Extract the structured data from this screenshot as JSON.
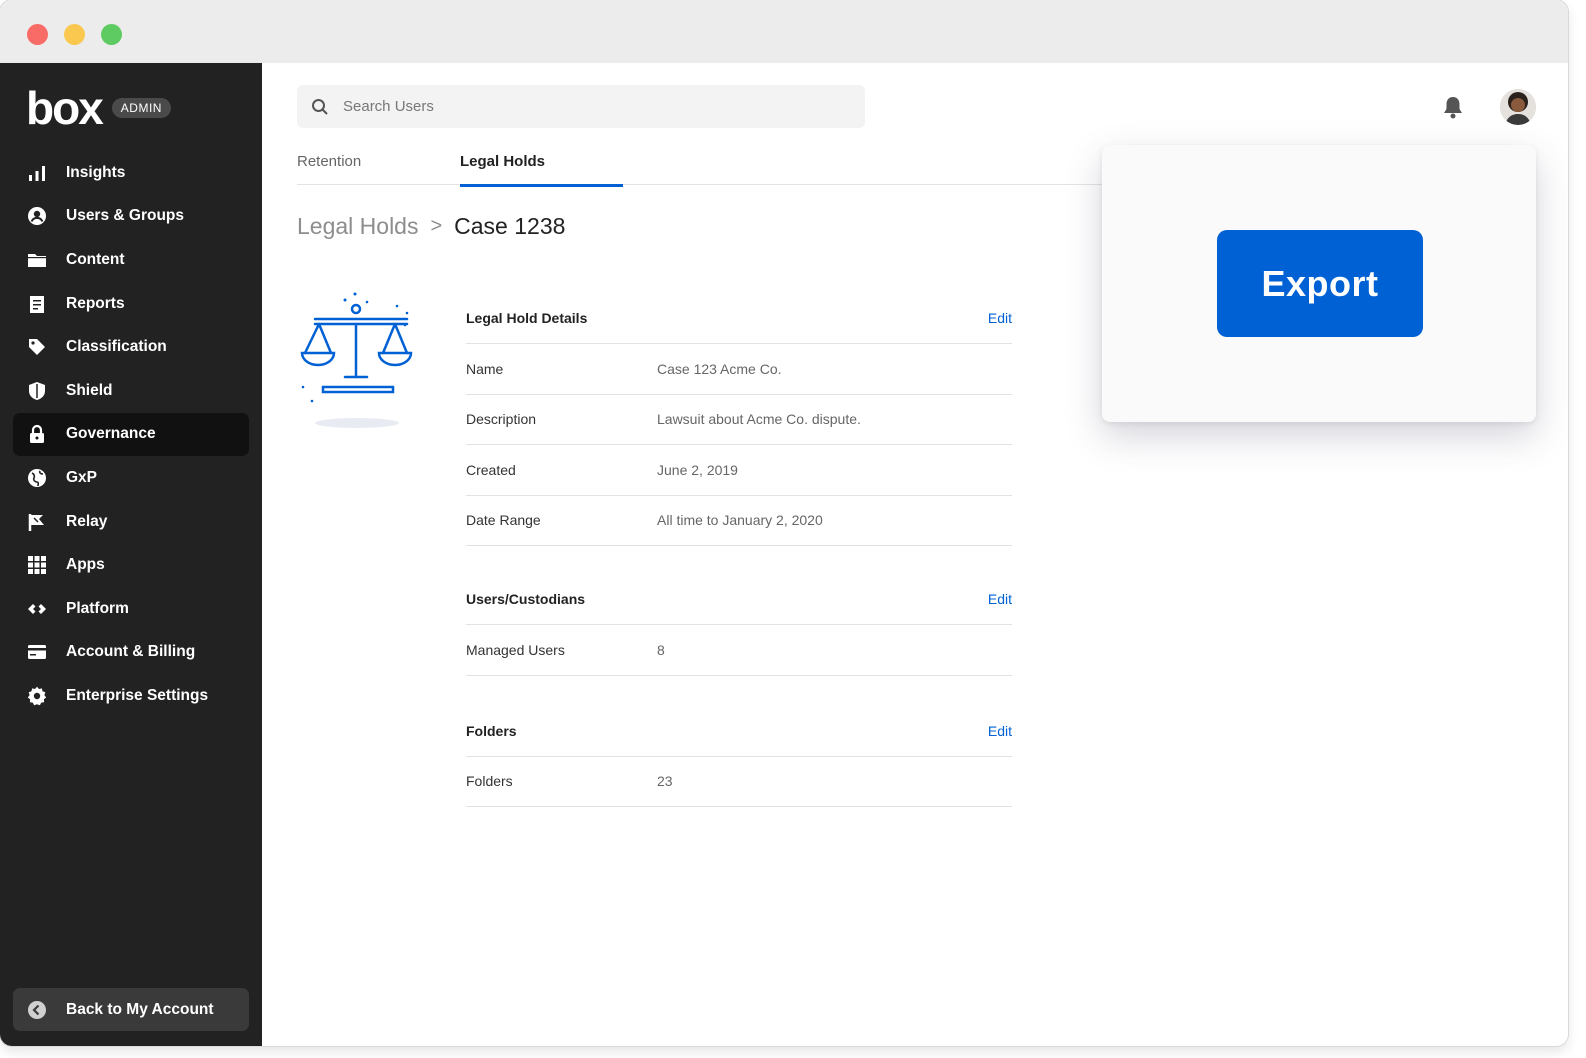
{
  "window": {
    "controls": [
      "close",
      "minimize",
      "zoom"
    ]
  },
  "sidebar": {
    "logo_text": "box",
    "badge": "ADMIN",
    "items": [
      {
        "label": "Insights",
        "icon": "bar-chart-icon",
        "active": false
      },
      {
        "label": "Users & Groups",
        "icon": "user-circle-icon",
        "active": false
      },
      {
        "label": "Content",
        "icon": "folder-icon",
        "active": false
      },
      {
        "label": "Reports",
        "icon": "report-icon",
        "active": false
      },
      {
        "label": "Classification",
        "icon": "tag-icon",
        "active": false
      },
      {
        "label": "Shield",
        "icon": "shield-icon",
        "active": false
      },
      {
        "label": "Governance",
        "icon": "lock-icon",
        "active": true
      },
      {
        "label": "GxP",
        "icon": "globe-icon",
        "active": false
      },
      {
        "label": "Relay",
        "icon": "relay-icon",
        "active": false
      },
      {
        "label": "Apps",
        "icon": "grid-icon",
        "active": false
      },
      {
        "label": "Platform",
        "icon": "platform-icon",
        "active": false
      },
      {
        "label": "Account & Billing",
        "icon": "credit-card-icon",
        "active": false
      },
      {
        "label": "Enterprise Settings",
        "icon": "gear-icon",
        "active": false
      }
    ],
    "back_label": "Back to My Account"
  },
  "header": {
    "search_placeholder": "Search Users",
    "notification_icon": "bell-icon",
    "avatar_icon": "user-avatar"
  },
  "tabs": [
    {
      "label": "Retention",
      "active": false
    },
    {
      "label": "Legal Holds",
      "active": true
    }
  ],
  "breadcrumb": {
    "parent": "Legal Holds",
    "separator": ">",
    "current": "Case 1238"
  },
  "details": {
    "legal_hold": {
      "title": "Legal Hold Details",
      "edit": "Edit",
      "rows": [
        {
          "label": "Name",
          "value": "Case 123 Acme Co."
        },
        {
          "label": "Description",
          "value": "Lawsuit about Acme Co. dispute."
        },
        {
          "label": "Created",
          "value": "June 2, 2019"
        },
        {
          "label": "Date Range",
          "value": "All time to January 2, 2020"
        }
      ]
    },
    "custodians": {
      "title": "Users/Custodians",
      "edit": "Edit",
      "rows": [
        {
          "label": "Managed Users",
          "value": "8"
        }
      ]
    },
    "folders": {
      "title": "Folders",
      "edit": "Edit",
      "rows": [
        {
          "label": "Folders",
          "value": "23"
        }
      ]
    }
  },
  "export_panel": {
    "button_label": "Export"
  },
  "colors": {
    "sidebar_bg": "#222222",
    "accent": "#0061d5",
    "active_item_bg": "#111111"
  }
}
